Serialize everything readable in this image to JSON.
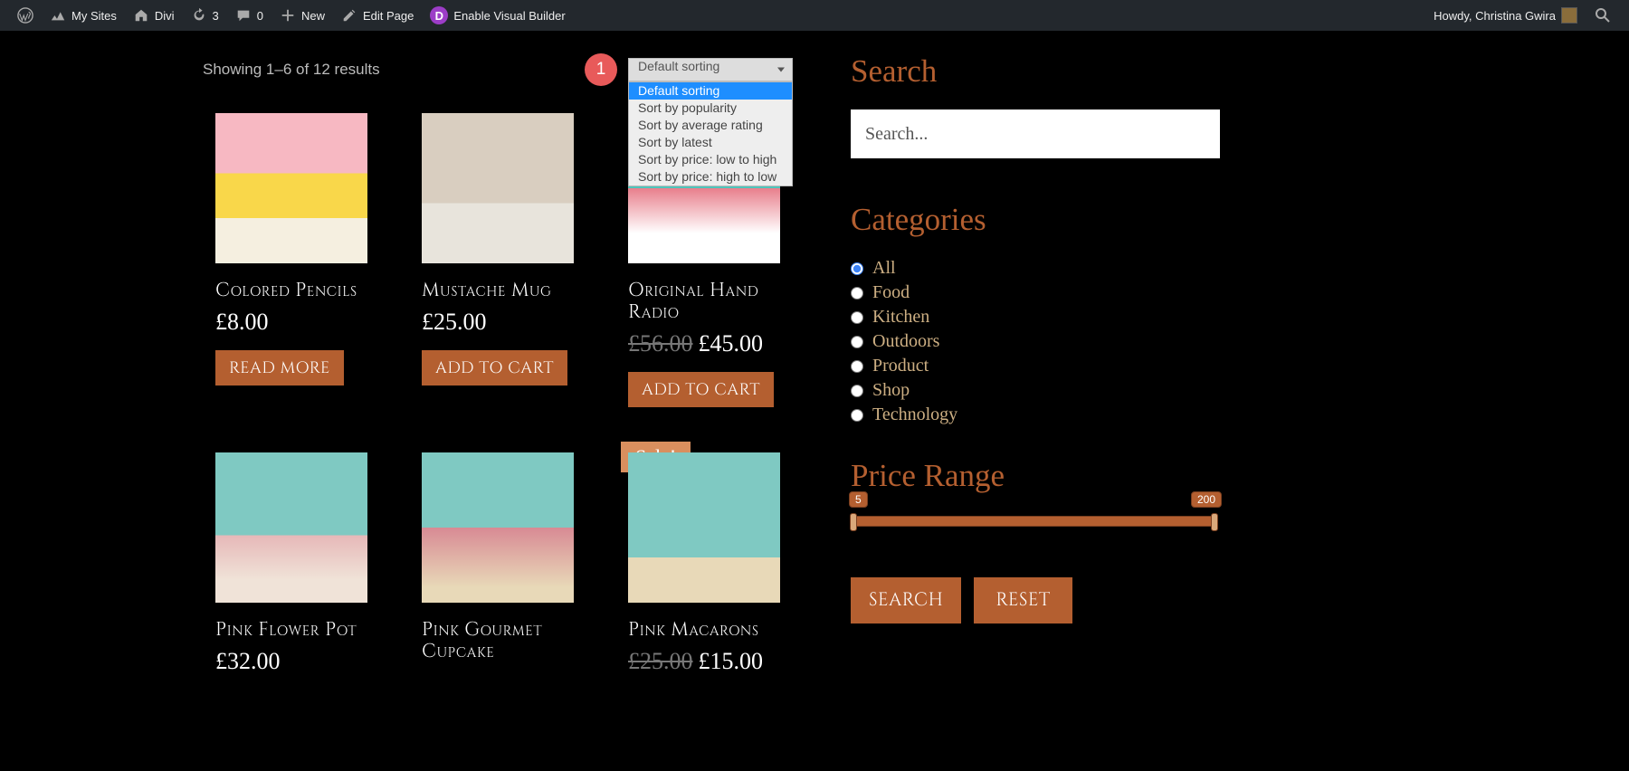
{
  "adminbar": {
    "mysites": "My Sites",
    "divi": "Divi",
    "updates": "3",
    "comments": "0",
    "new": "New",
    "edit": "Edit Page",
    "visual": "Enable Visual Builder",
    "howdy": "Howdy, Christina Gwira"
  },
  "shop": {
    "result_count": "Showing 1–6 of 12 results",
    "sort_selected": "Default sorting",
    "sort_options": [
      "Default sorting",
      "Sort by popularity",
      "Sort by average rating",
      "Sort by latest",
      "Sort by price: low to high",
      "Sort by price: high to low"
    ],
    "badge": "1",
    "products": [
      {
        "title": "Colored Pencils",
        "price": "£8.00",
        "old": "",
        "btn": "READ MORE",
        "sale": false
      },
      {
        "title": "Mustache Mug",
        "price": "£25.00",
        "old": "",
        "btn": "ADD TO CART",
        "sale": false
      },
      {
        "title": "Original Hand Radio",
        "price": "£45.00",
        "old": "£56.00",
        "btn": "ADD TO CART",
        "sale": false
      },
      {
        "title": "Pink Flower Pot",
        "price": "£32.00",
        "old": "",
        "btn": "",
        "sale": false
      },
      {
        "title": "Pink Gourmet Cupcake",
        "price": "",
        "old": "",
        "btn": "",
        "sale": false
      },
      {
        "title": "Pink Macarons",
        "price": "£15.00",
        "old": "£25.00",
        "btn": "",
        "sale": true
      }
    ],
    "sale_label": "Sale!"
  },
  "sidebar": {
    "search_heading": "Search",
    "search_placeholder": "Search...",
    "cat_heading": "Categories",
    "categories": [
      "All",
      "Food",
      "Kitchen",
      "Outdoors",
      "Product",
      "Shop",
      "Technology"
    ],
    "selected_category": "All",
    "price_heading": "Price Range",
    "price_min": "5",
    "price_max": "200",
    "search_btn": "SEARCH",
    "reset_btn": "RESET"
  }
}
